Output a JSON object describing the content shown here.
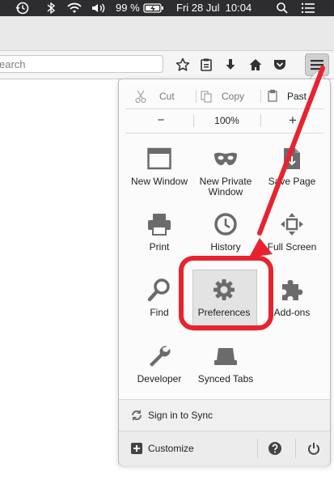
{
  "menubar": {
    "battery": "99 %",
    "datetime": "Fri 28 Jul  10:04",
    "icons": [
      "time-machine-icon",
      "bluetooth-icon",
      "wifi-icon",
      "volume-icon",
      "battery-icon",
      "search-icon",
      "menu-list-icon"
    ]
  },
  "toolbar": {
    "search_value": "earch",
    "icons": [
      "bookmark-star-icon",
      "reading-list-icon",
      "downloads-icon",
      "home-icon",
      "pocket-icon",
      "hamburger-menu-icon"
    ]
  },
  "panel": {
    "edit": {
      "cut": "Cut",
      "copy": "Copy",
      "paste": "Past"
    },
    "zoom": {
      "minus": "−",
      "level": "100%",
      "plus": "+"
    },
    "tiles": {
      "new_window": "New Window",
      "private_line1": "New Private",
      "private_line2": "Window",
      "save_page": "Save Page",
      "print": "Print",
      "history": "History",
      "full_screen": "Full Screen",
      "find": "Find",
      "preferences": "Preferences",
      "addons": "Add-ons",
      "developer": "Developer",
      "synced_tabs": "Synced Tabs"
    },
    "sync": "Sign in to Sync",
    "customize": "Customize"
  },
  "colors": {
    "annotation": "#e8232f",
    "icon": "#6b6b6b",
    "menubar": "#2d2c2e"
  }
}
